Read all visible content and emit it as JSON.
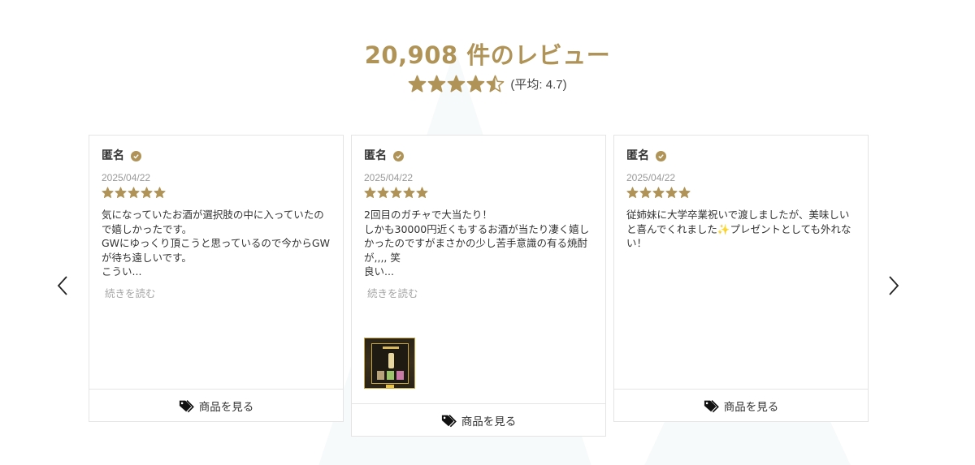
{
  "header": {
    "title": "20,908 件のレビュー",
    "rating_value": 4.7,
    "average_text": "(平均: 4.7)"
  },
  "colors": {
    "accent": "#b09357",
    "border": "#e4e4e4",
    "muted": "#999999"
  },
  "nav": {
    "prev_icon": "chevron-left-icon",
    "next_icon": "chevron-right-icon"
  },
  "reviews": [
    {
      "name": "匿名",
      "date": "2025/04/22",
      "stars": 5,
      "text": "気になっていたお酒が選択肢の中に入っていたので嬉しかったです。\nGWにゆっくり頂こうと思っているので今からGWが待ち遠しいです。\nこうい...",
      "read_more": "続きを読む",
      "has_photo": false,
      "view_product": "商品を見る"
    },
    {
      "name": "匿名",
      "date": "2025/04/22",
      "stars": 5,
      "text": "2回目のガチャで大当たり！\nしかも30000円近くもするお酒が当たり凄く嬉しかったのですがまさかの少し苦手意識の有る焼酎が,,,, 笑\n良い...",
      "read_more": "続きを読む",
      "has_photo": true,
      "view_product": "商品を見る"
    },
    {
      "name": "匿名",
      "date": "2025/04/22",
      "stars": 5,
      "text": "従姉妹に大学卒業祝いで渡しましたが、美味しいと喜んでくれました✨プレゼントとしても外れない！",
      "read_more": "",
      "has_photo": false,
      "view_product": "商品を見る"
    }
  ]
}
